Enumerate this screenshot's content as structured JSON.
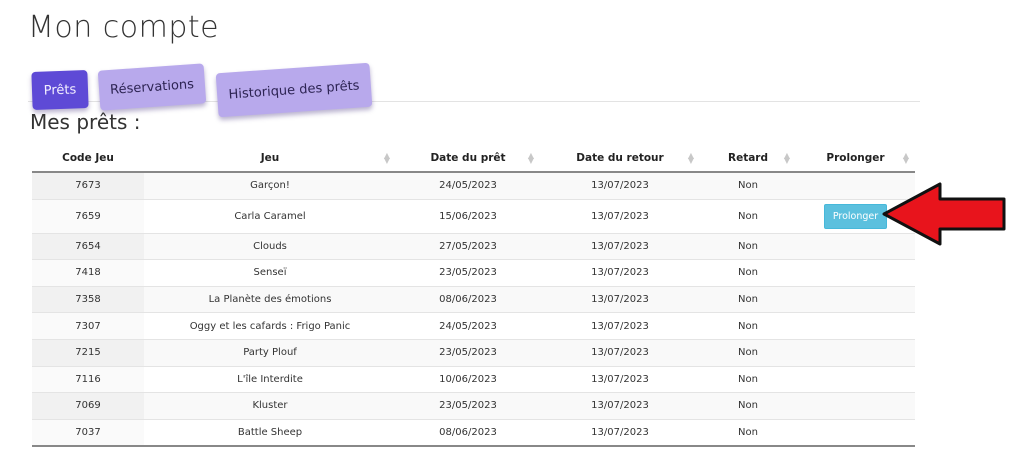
{
  "page": {
    "title": "Mon compte",
    "section_title": "Mes prêts :"
  },
  "tabs": [
    {
      "label": "Prêts",
      "active": true
    },
    {
      "label": "Réservations",
      "active": false
    },
    {
      "label": "Historique des prêts",
      "active": false
    }
  ],
  "colors": {
    "active_tab": "#5e4ad6",
    "inactive_tab": "#b8a9ec",
    "extend_button": "#5bc0de",
    "annotation_arrow": "#e8141c"
  },
  "table": {
    "columns": [
      "Code Jeu",
      "Jeu",
      "Date du prêt",
      "Date du retour",
      "Retard",
      "Prolonger"
    ],
    "sort_icon": "sort-arrows-icon",
    "extend_label": "Prolonger",
    "rows": [
      {
        "code": "7673",
        "game": "Garçon!",
        "loan_date": "24/05/2023",
        "return_date": "13/07/2023",
        "late": "Non"
      },
      {
        "code": "7659",
        "game": "Carla Caramel",
        "loan_date": "15/06/2023",
        "return_date": "13/07/2023",
        "late": "Non",
        "extend": true
      },
      {
        "code": "7654",
        "game": "Clouds",
        "loan_date": "27/05/2023",
        "return_date": "13/07/2023",
        "late": "Non"
      },
      {
        "code": "7418",
        "game": "Senseï",
        "loan_date": "23/05/2023",
        "return_date": "13/07/2023",
        "late": "Non"
      },
      {
        "code": "7358",
        "game": "La Planète des émotions",
        "loan_date": "08/06/2023",
        "return_date": "13/07/2023",
        "late": "Non"
      },
      {
        "code": "7307",
        "game": "Oggy et les cafards : Frigo Panic",
        "loan_date": "24/05/2023",
        "return_date": "13/07/2023",
        "late": "Non"
      },
      {
        "code": "7215",
        "game": "Party Plouf",
        "loan_date": "23/05/2023",
        "return_date": "13/07/2023",
        "late": "Non"
      },
      {
        "code": "7116",
        "game": "L'île Interdite",
        "loan_date": "10/06/2023",
        "return_date": "13/07/2023",
        "late": "Non"
      },
      {
        "code": "7069",
        "game": "Kluster",
        "loan_date": "23/05/2023",
        "return_date": "13/07/2023",
        "late": "Non"
      },
      {
        "code": "7037",
        "game": "Battle Sheep",
        "loan_date": "08/06/2023",
        "return_date": "13/07/2023",
        "late": "Non"
      }
    ]
  }
}
